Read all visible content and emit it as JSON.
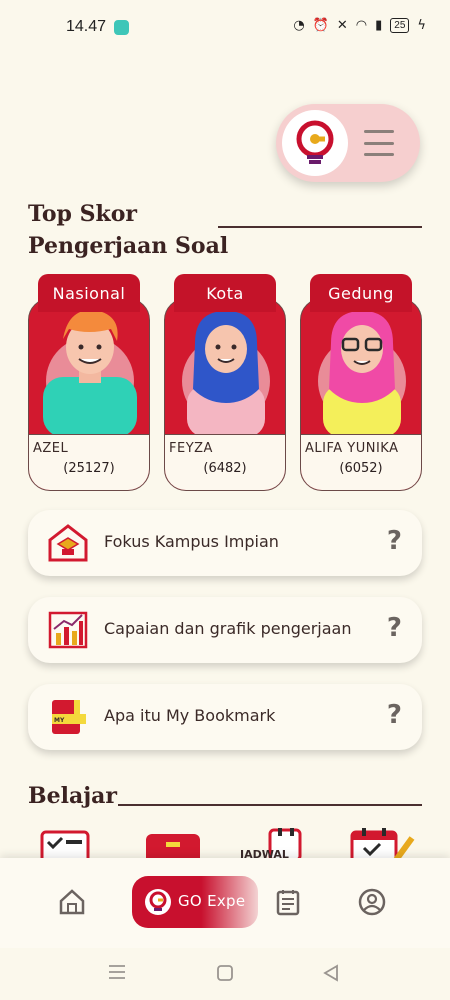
{
  "status_bar": {
    "time": "14.47",
    "battery": "25"
  },
  "header": {
    "logo": "go-logo-icon",
    "menu": "hamburger-icon"
  },
  "top_score": {
    "title_line1": "Top Skor",
    "title_line2": "Pengerjaan Soal",
    "cards": [
      {
        "tab": "Nasional",
        "name": "AZEL",
        "score": "(25127)"
      },
      {
        "tab": "Kota",
        "name": "FEYZA",
        "score": "(6482)"
      },
      {
        "tab": "Gedung",
        "name": "ALIFA YUNIKA",
        "score": "(6052)"
      }
    ]
  },
  "info_rows": [
    {
      "label": "Fokus Kampus Impian",
      "icon": "campus-icon",
      "help": "?"
    },
    {
      "label": "Capaian dan grafik pengerjaan",
      "icon": "chart-icon",
      "help": "?"
    },
    {
      "label": "Apa itu My Bookmark",
      "icon": "bookmark-book-icon",
      "help": "?"
    }
  ],
  "belajar": {
    "title": "Belajar",
    "peek_text": "JADWAL"
  },
  "bottom_nav": {
    "items": [
      {
        "icon": "home-icon"
      },
      {
        "icon": "go-logo-icon",
        "label": "GO Expe"
      },
      {
        "icon": "calendar-note-icon"
      },
      {
        "icon": "profile-icon"
      }
    ]
  },
  "colors": {
    "primary_red": "#c8102e",
    "background": "#fbf8ec",
    "pill_pink": "#f6cfcf"
  }
}
